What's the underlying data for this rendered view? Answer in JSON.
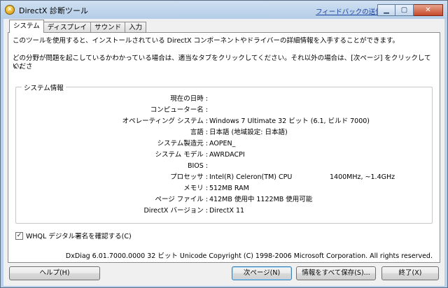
{
  "window": {
    "title": "DirectX 診断ツール",
    "feedback_link": "フィードバックの送信",
    "minimize_glyph": "▁",
    "maximize_glyph": "▢",
    "close_glyph": "✕",
    "app_icon": "directx-icon"
  },
  "tabs": [
    {
      "label": "システム",
      "active": true
    },
    {
      "label": "ディスプレイ",
      "active": false
    },
    {
      "label": "サウンド",
      "active": false
    },
    {
      "label": "入力",
      "active": false
    }
  ],
  "intro": {
    "line1": "このツールを使用すると、インストールされている DirectX コンポーネントやドライバーの詳細情報を入手することができます。",
    "line2": "どの分野が問題を起こしているかわかっている場合は、適当なタブをクリックしてください。それ以外の場合は、[次ページ] をクリックしてくださ",
    "line3": "い。"
  },
  "system_info": {
    "group_title": "システム情報",
    "rows": [
      {
        "label": "現在の日時 :",
        "value": ""
      },
      {
        "label": "コンピューター名 :",
        "value": ""
      },
      {
        "label": "オペレーティング システム :",
        "value": "Windows 7 Ultimate 32 ビット (6.1, ビルド 7000)"
      },
      {
        "label": "言語 :",
        "value": "日本語 (地域設定: 日本語)"
      },
      {
        "label": "システム製造元 :",
        "value": "AOPEN_"
      },
      {
        "label": "システム モデル :",
        "value": "AWRDACPI"
      },
      {
        "label": "BIOS :",
        "value": ""
      },
      {
        "label": "プロセッサ :",
        "value": "Intel(R) Celeron(TM) CPU",
        "extra": "1400MHz, ~1.4GHz"
      },
      {
        "label": "メモリ :",
        "value": "512MB RAM"
      },
      {
        "label": "ページ ファイル :",
        "value": "412MB 使用中 1122MB 使用可能"
      },
      {
        "label": "DirectX バージョン :",
        "value": "DirectX 11"
      }
    ]
  },
  "whql": {
    "label": "WHQL デジタル署名を確認する(C)",
    "checked": true,
    "check_glyph": "✓"
  },
  "footer_info": "DxDiag 6.01.7000.0000 32 ビット Unicode  Copyright (C) 1998-2006 Microsoft Corporation.  All rights reserved.",
  "buttons": {
    "help": "ヘルプ(H)",
    "next": "次ページ(N)",
    "save": "情報をすべて保存(S)...",
    "exit": "終了(X)"
  }
}
